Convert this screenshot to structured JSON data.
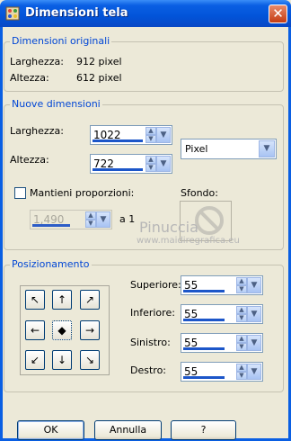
{
  "window": {
    "title": "Dimensioni tela"
  },
  "original": {
    "legend": "Dimensioni originali",
    "width_label": "Larghezza:",
    "width_value": "912 pixel",
    "height_label": "Altezza:",
    "height_value": "612 pixel"
  },
  "new_dims": {
    "legend": "Nuove dimensioni",
    "width_label": "Larghezza:",
    "width_value": "1022",
    "height_label": "Altezza:",
    "height_value": "722",
    "units": "Pixel",
    "keep_ratio_label": "Mantieni proporzioni:",
    "ratio_value": "1,490",
    "ratio_suffix": "a 1",
    "background_label": "Sfondo:"
  },
  "position": {
    "legend": "Posizionamento",
    "top_label": "Superiore:",
    "top_value": "55",
    "bottom_label": "Inferiore:",
    "bottom_value": "55",
    "left_label": "Sinistro:",
    "left_value": "55",
    "right_label": "Destro:",
    "right_value": "55",
    "grid": [
      "↖",
      "↑",
      "↗",
      "←",
      "◆",
      "→",
      "↙",
      "↓",
      "↘"
    ]
  },
  "buttons": {
    "ok": "OK",
    "cancel": "Annulla",
    "help": "?"
  },
  "watermark": {
    "name": "Pinuccia",
    "site": "www.maidiregrafica.eu"
  },
  "colors": {
    "titlebar": "#0a5fe3",
    "legend": "#0046d5",
    "dialog_bg": "#ece9d8"
  }
}
